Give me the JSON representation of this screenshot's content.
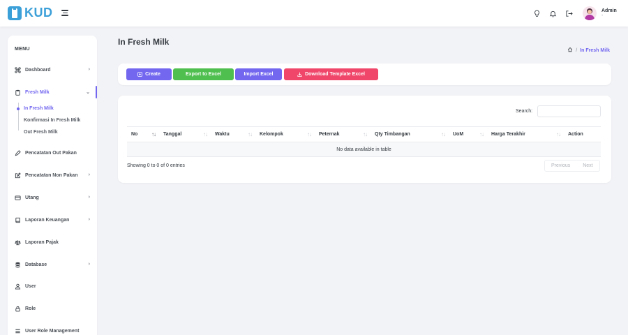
{
  "app": {
    "brand": "KUD"
  },
  "user": {
    "name": "Admin",
    "sub": "-"
  },
  "sidebar": {
    "title": "MENU",
    "items": [
      {
        "label": "Dashboard",
        "icon": "command-icon",
        "chevron": "›"
      },
      {
        "label": "Fresh Milk",
        "icon": "clipboard-icon",
        "chevron": "⌄"
      },
      {
        "label": "Pencatatan Out Pakan",
        "icon": "pencil-icon",
        "chevron": ""
      },
      {
        "label": "Pencatatan Non Pakan",
        "icon": "edit-icon",
        "chevron": "›"
      },
      {
        "label": "Utang",
        "icon": "credit-card-icon",
        "chevron": "›"
      },
      {
        "label": "Laporan Keuangan",
        "icon": "book-icon",
        "chevron": "›"
      },
      {
        "label": "Laporan Pajak",
        "icon": "scale-icon",
        "chevron": ""
      },
      {
        "label": "Database",
        "icon": "database-icon",
        "chevron": "›"
      },
      {
        "label": "User",
        "icon": "user-icon",
        "chevron": ""
      },
      {
        "label": "Role",
        "icon": "lock-icon",
        "chevron": ""
      },
      {
        "label": "User Role Management",
        "icon": "list-icon",
        "chevron": ""
      }
    ],
    "sub_items": [
      {
        "label": "In Fresh Milk"
      },
      {
        "label": "Konfirmasi In Fresh Milk"
      },
      {
        "label": "Out Fresh Milk"
      }
    ]
  },
  "page": {
    "title": "In Fresh Milk"
  },
  "breadcrumb": {
    "separator": "/",
    "current": "In Fresh Milk"
  },
  "actions": {
    "create": "Create",
    "export": "Export to Excel",
    "import": "Import Excel",
    "download": "Download Template Excel"
  },
  "table": {
    "search_label": "Search:",
    "search_value": "",
    "columns": [
      "No",
      "Tanggal",
      "Waktu",
      "Kelompok",
      "Peternak",
      "Qty Timbangan",
      "UoM",
      "Harga Terakhir",
      "Action"
    ],
    "sort_glyph": "↑↓",
    "empty_text": "No data available in table",
    "info": "Showing 0 to 0 of 0 entries",
    "prev": "Previous",
    "next": "Next"
  },
  "colors": {
    "accent": "#7367f0",
    "success": "#4fbf4f",
    "danger": "#f0466a",
    "brand": "#3b9fd8"
  }
}
